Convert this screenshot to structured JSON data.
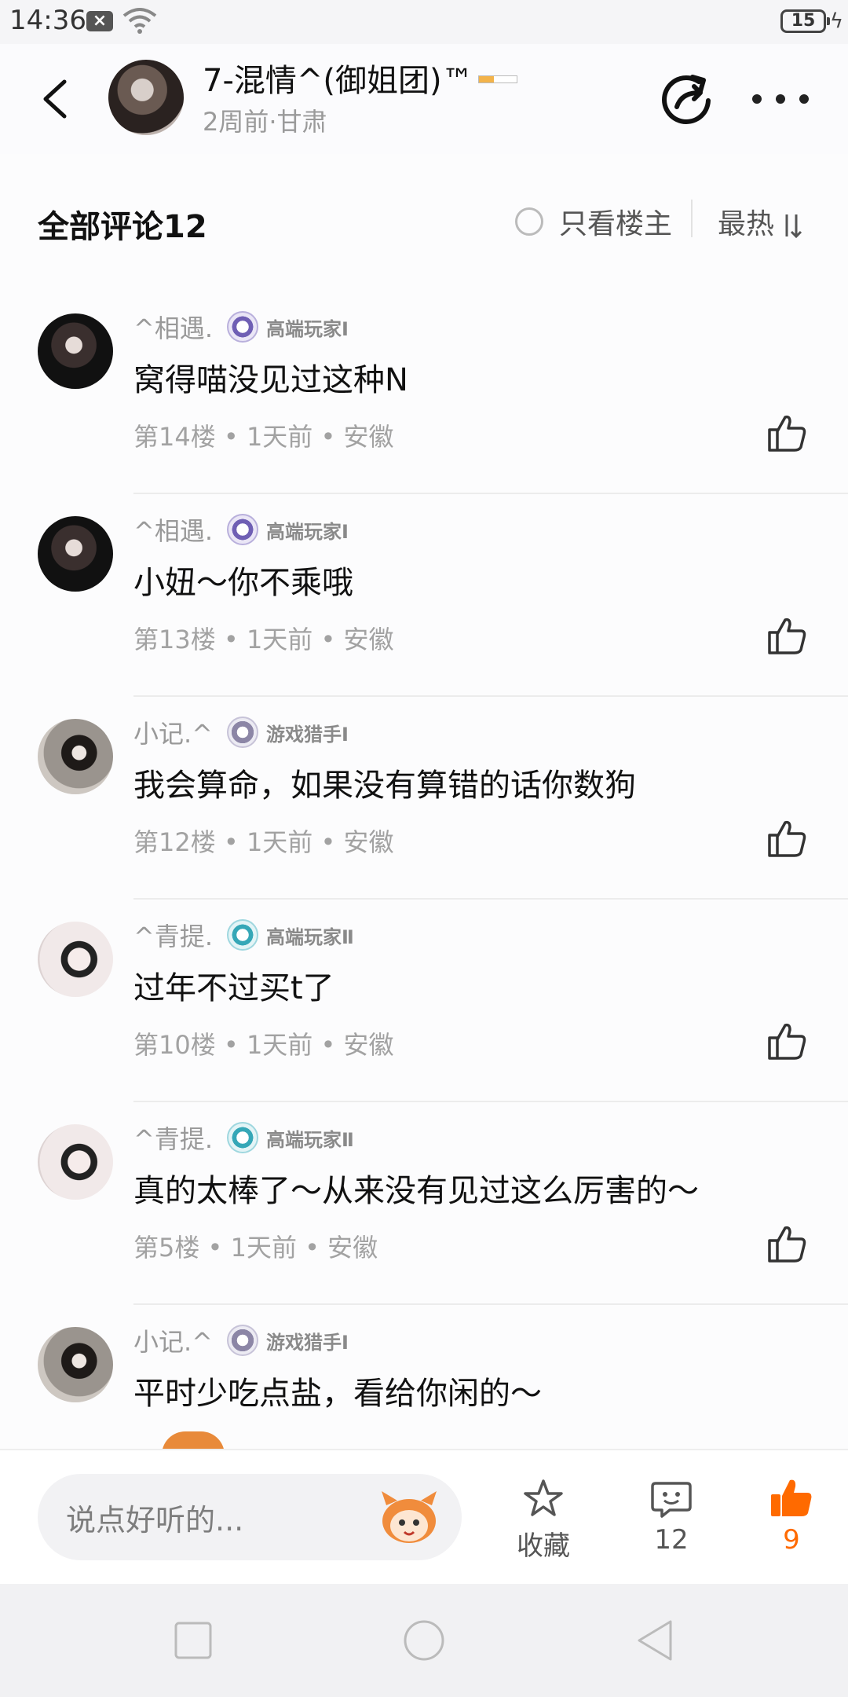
{
  "status_bar": {
    "time": "14:36",
    "battery": "15"
  },
  "header": {
    "title": "7-混情^(御姐团)™",
    "subtitle": "2周前·甘肃"
  },
  "comments_section": {
    "title": "全部评论12",
    "only_op_label": "只看楼主",
    "sort_label": "最热"
  },
  "comments": [
    {
      "user": "^相遇.",
      "badge": "高端玩家Ⅰ",
      "badge_color": "#6f5fb4",
      "text": "窝得喵没见过这种N",
      "meta": "第14楼 • 1天前 • 安徽"
    },
    {
      "user": "^相遇.",
      "badge": "高端玩家Ⅰ",
      "badge_color": "#6f5fb4",
      "text": "小妞～你不乘哦",
      "meta": "第13楼 • 1天前 • 安徽"
    },
    {
      "user": "小记.^",
      "badge": "游戏猎手Ⅰ",
      "badge_color": "#8c86a6",
      "text": "我会算命，如果没有算错的话你数狗",
      "meta": "第12楼 • 1天前 • 安徽"
    },
    {
      "user": "^青提.",
      "badge": "高端玩家Ⅱ",
      "badge_color": "#35a7b7",
      "text": "过年不过买t了",
      "meta": "第10楼 • 1天前 • 安徽"
    },
    {
      "user": "^青提.",
      "badge": "高端玩家Ⅱ",
      "badge_color": "#35a7b7",
      "text": "真的太棒了～从来没有见过这么厉害的～",
      "meta": "第5楼 • 1天前 • 安徽"
    },
    {
      "user": "小记.^",
      "badge": "游戏猎手Ⅰ",
      "badge_color": "#8c86a6",
      "text": "平时少吃点盐，看给你闲的～",
      "meta": ""
    }
  ],
  "bottom_bar": {
    "input_placeholder": "说点好听的...",
    "favorite_label": "收藏",
    "comment_count": "12",
    "like_count": "9",
    "accent_color": "#ff6a00"
  },
  "icons": [
    "back-arrow-icon",
    "share-icon",
    "more-icon",
    "radio-icon",
    "sort-icon",
    "like-icon",
    "mascot-icon",
    "star-icon",
    "comment-icon",
    "thumb-up-filled-icon",
    "nav-recent-icon",
    "nav-home-icon",
    "nav-back-icon"
  ]
}
